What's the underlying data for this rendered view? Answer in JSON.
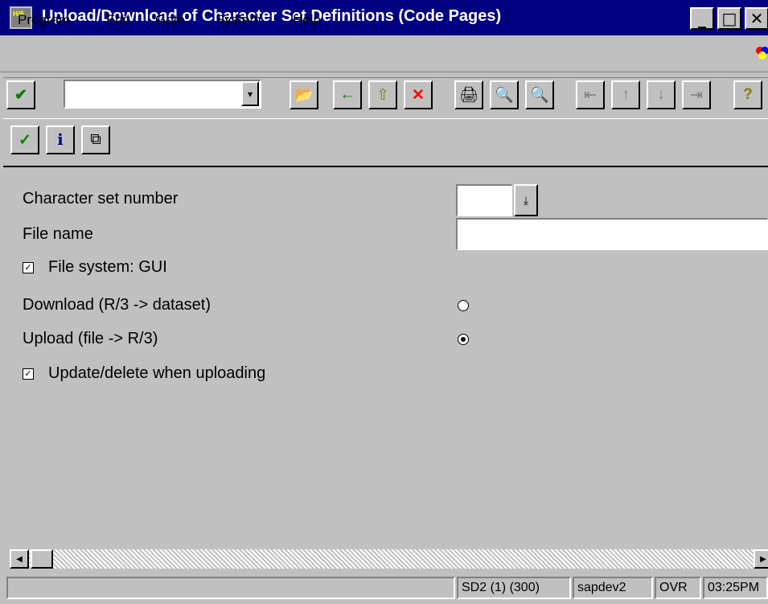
{
  "window": {
    "title": "Upload/Download of Character Set Definitions (Code Pages)",
    "app_icon_text": "H/6",
    "minimize": "_",
    "maximize": "□",
    "close": "✕"
  },
  "menu": [
    "Program",
    "Edit",
    "Goto",
    "System",
    "Help"
  ],
  "toolbar": {
    "enter": "✔",
    "command_value": "",
    "dropdown": "▾",
    "buttons": [
      "📂",
      "←",
      "⇧",
      "✕",
      "🖨",
      "🔍",
      "🔍",
      "⇤",
      "↑",
      "↓",
      "⇥",
      "?"
    ]
  },
  "app_toolbar": {
    "buttons": [
      "✓",
      "ℹ",
      "⧉"
    ]
  },
  "form": {
    "char_set_label": "Character set number",
    "char_set_value": "",
    "dropdown": "⤓",
    "file_name_label": "File name",
    "file_name_value": "",
    "file_system_label": "File system: GUI",
    "file_system_checked": true,
    "download_label": "Download (R/3 -> dataset)",
    "download_selected": false,
    "upload_label": "Upload (file -> R/3)",
    "upload_selected": true,
    "update_delete_label": "Update/delete when uploading",
    "update_delete_checked": true,
    "checkmark": "✓"
  },
  "scrollbar": {
    "left": "◀",
    "right": "▶"
  },
  "status": {
    "message": "",
    "system": "SD2 (1) (300)",
    "server": "sapdev2",
    "mode": "OVR",
    "time": "03:25PM"
  }
}
